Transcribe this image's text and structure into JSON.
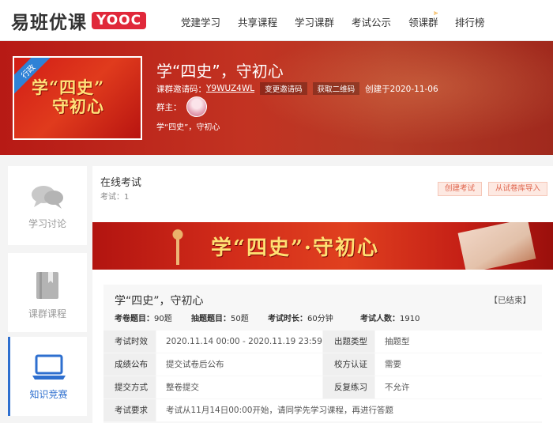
{
  "header": {
    "logo_text": "易班优课",
    "logo_badge": "YOOC",
    "nav": [
      "党建学习",
      "共享课程",
      "学习课群",
      "考试公示",
      "领课群",
      "排行榜"
    ]
  },
  "course": {
    "cover_tag": "行政",
    "cover_line1": "学“四史”",
    "cover_line2": "守初心",
    "title": "学“四史”，守初心",
    "invite_label": "课群邀请码：",
    "invite_code": "Y9WUZ4WL",
    "change_code_button": "变更邀请码",
    "qr_button": "获取二维码",
    "created": "创建于2020-11-06",
    "owner_label": "群主：",
    "description": "学“四史”，守初心"
  },
  "sidebar": {
    "items": [
      {
        "label": "学习讨论",
        "icon": "chat-bubbles-icon"
      },
      {
        "label": "课群课程",
        "icon": "book-icon"
      },
      {
        "label": "知识竞赛",
        "icon": "laptop-icon"
      }
    ]
  },
  "exam_section": {
    "title": "在线考试",
    "count": "考试：1",
    "create_button": "创建考试",
    "import_button": "从试卷库导入",
    "promo_text": "学“四史”·守初心"
  },
  "exam": {
    "title": "学“四史”，守初心",
    "status": "【已结束】",
    "stats": [
      {
        "k": "考卷题目：",
        "v": "90题"
      },
      {
        "k": "抽题题目：",
        "v": "50题"
      },
      {
        "k": "考试时长：",
        "v": "60分钟"
      },
      {
        "k": "考试人数：",
        "v": "1910"
      }
    ],
    "rows": [
      {
        "k1": "考试时效",
        "v1": "2020.11.14 00:00 - 2020.11.19 23:59",
        "k2": "出题类型",
        "v2": "抽题型"
      },
      {
        "k1": "成绩公布",
        "v1": "提交试卷后公布",
        "k2": "校方认证",
        "v2": "需要"
      },
      {
        "k1": "提交方式",
        "v1": "整卷提交",
        "k2": "反复练习",
        "v2": "不允许"
      },
      {
        "k1": "考试要求",
        "v1": "考试从11月14日00:00开始，请同学先学习课程，再进行答题",
        "k2": "",
        "v2": ""
      }
    ]
  },
  "colors": {
    "brand_red": "#e0283a",
    "active_blue": "#2e6fcf"
  }
}
